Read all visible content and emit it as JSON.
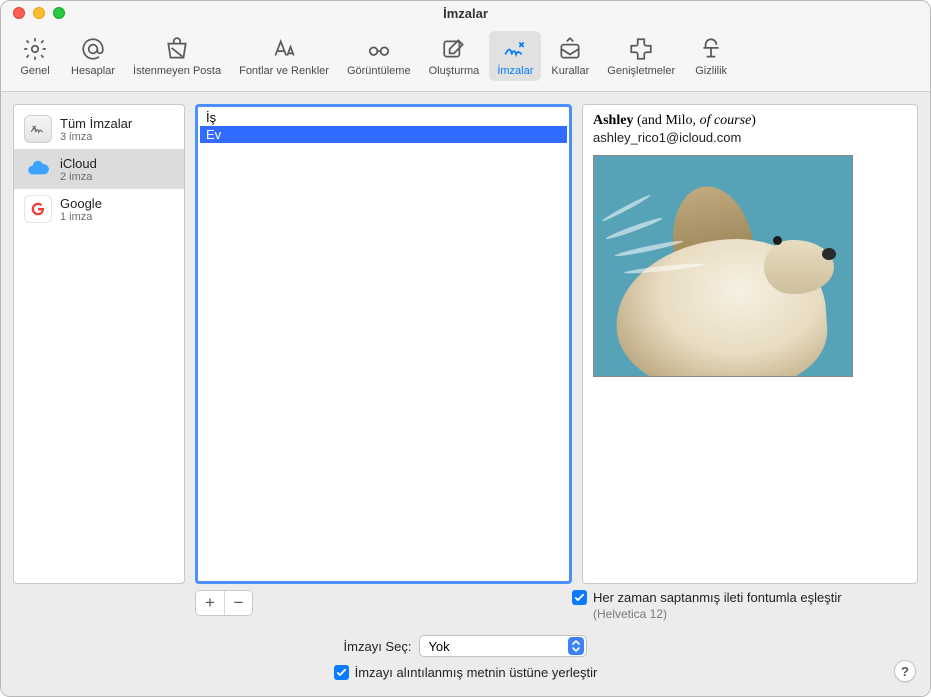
{
  "window": {
    "title": "İmzalar"
  },
  "toolbar": {
    "items": [
      {
        "label": "Genel",
        "icon": "gear-icon"
      },
      {
        "label": "Hesaplar",
        "icon": "at-icon"
      },
      {
        "label": "İstenmeyen Posta",
        "icon": "junk-icon"
      },
      {
        "label": "Fontlar ve Renkler",
        "icon": "fonts-icon"
      },
      {
        "label": "Görüntüleme",
        "icon": "glasses-icon"
      },
      {
        "label": "Oluşturma",
        "icon": "compose-icon"
      },
      {
        "label": "İmzalar",
        "icon": "signature-icon"
      },
      {
        "label": "Kurallar",
        "icon": "rules-icon"
      },
      {
        "label": "Genişletmeler",
        "icon": "extensions-icon"
      },
      {
        "label": "Gizlilik",
        "icon": "privacy-icon"
      }
    ],
    "selected_index": 6
  },
  "accounts": {
    "items": [
      {
        "name": "Tüm İmzalar",
        "sub": "3 imza",
        "icon": "all"
      },
      {
        "name": "iCloud",
        "sub": "2 imza",
        "icon": "icloud"
      },
      {
        "name": "Google",
        "sub": "1 imza",
        "icon": "google"
      }
    ],
    "selected_index": 1
  },
  "signatures": {
    "items": [
      {
        "label": "İş"
      },
      {
        "label": "Ev"
      }
    ],
    "selected_index": 1
  },
  "preview": {
    "name": "Ashley",
    "paren_prefix": " (and Milo, ",
    "italic": "of course",
    "paren_suffix": ")",
    "email": "ashley_rico1@icloud.com"
  },
  "options": {
    "match_font_label": "Her zaman saptanmış ileti fontumla eşleştir",
    "match_font_checked": true,
    "font_annotation": "(Helvetica 12)",
    "choose_label": "İmzayı Seç:",
    "choose_value": "Yok",
    "above_quoted_label": "İmzayı alıntılanmış metnin üstüne yerleştir",
    "above_quoted_checked": true
  },
  "help": {
    "glyph": "?"
  },
  "addremove": {
    "add": "+",
    "remove": "−"
  }
}
